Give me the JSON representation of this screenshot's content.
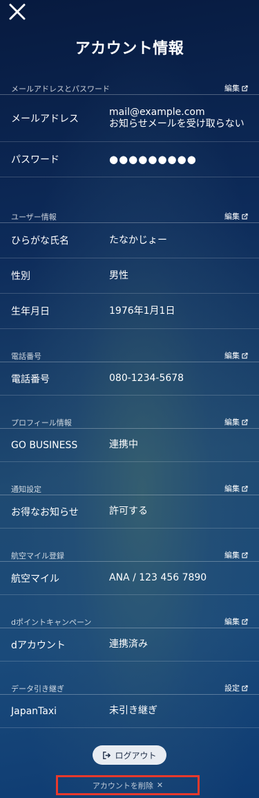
{
  "header": {
    "title": "アカウント情報"
  },
  "sections": [
    {
      "title": "メールアドレスとパスワード",
      "action": "編集",
      "rows": [
        {
          "label": "メールアドレス",
          "value": "mail@example.com",
          "value2": "お知らせメールを受け取らない"
        },
        {
          "label": "パスワード",
          "value": "●●●●●●●●●"
        }
      ]
    },
    {
      "title": "ユーザー情報",
      "action": "編集",
      "rows": [
        {
          "label": "ひらがな氏名",
          "value": "たなかじょー"
        },
        {
          "label": "性別",
          "value": "男性"
        },
        {
          "label": "生年月日",
          "value": "1976年1月1日"
        }
      ]
    },
    {
      "title": "電話番号",
      "action": "編集",
      "rows": [
        {
          "label": "電話番号",
          "value": "080-1234-5678"
        }
      ]
    },
    {
      "title": "プロフィール情報",
      "action": "編集",
      "rows": [
        {
          "label": "GO BUSINESS",
          "value": "連携中"
        }
      ]
    },
    {
      "title": "通知設定",
      "action": "編集",
      "rows": [
        {
          "label": "お得なお知らせ",
          "value": "許可する"
        }
      ]
    },
    {
      "title": "航空マイル登録",
      "action": "編集",
      "rows": [
        {
          "label": "航空マイル",
          "value": "ANA / 123 456 7890"
        }
      ]
    },
    {
      "title": "dポイントキャンペーン",
      "action": "編集",
      "rows": [
        {
          "label": "dアカウント",
          "value": "連携済み"
        }
      ]
    },
    {
      "title": "データ引き継ぎ",
      "action": "設定",
      "rows": [
        {
          "label": "JapanTaxi",
          "value": "未引き継ぎ"
        }
      ]
    }
  ],
  "footer": {
    "logout_label": "ログアウト",
    "delete_label": "アカウントを削除",
    "delete_icon": "✕"
  },
  "colors": {
    "highlight_border": "#e8392b",
    "background_top": "#071a3f",
    "background_bottom": "#0d3a72"
  }
}
